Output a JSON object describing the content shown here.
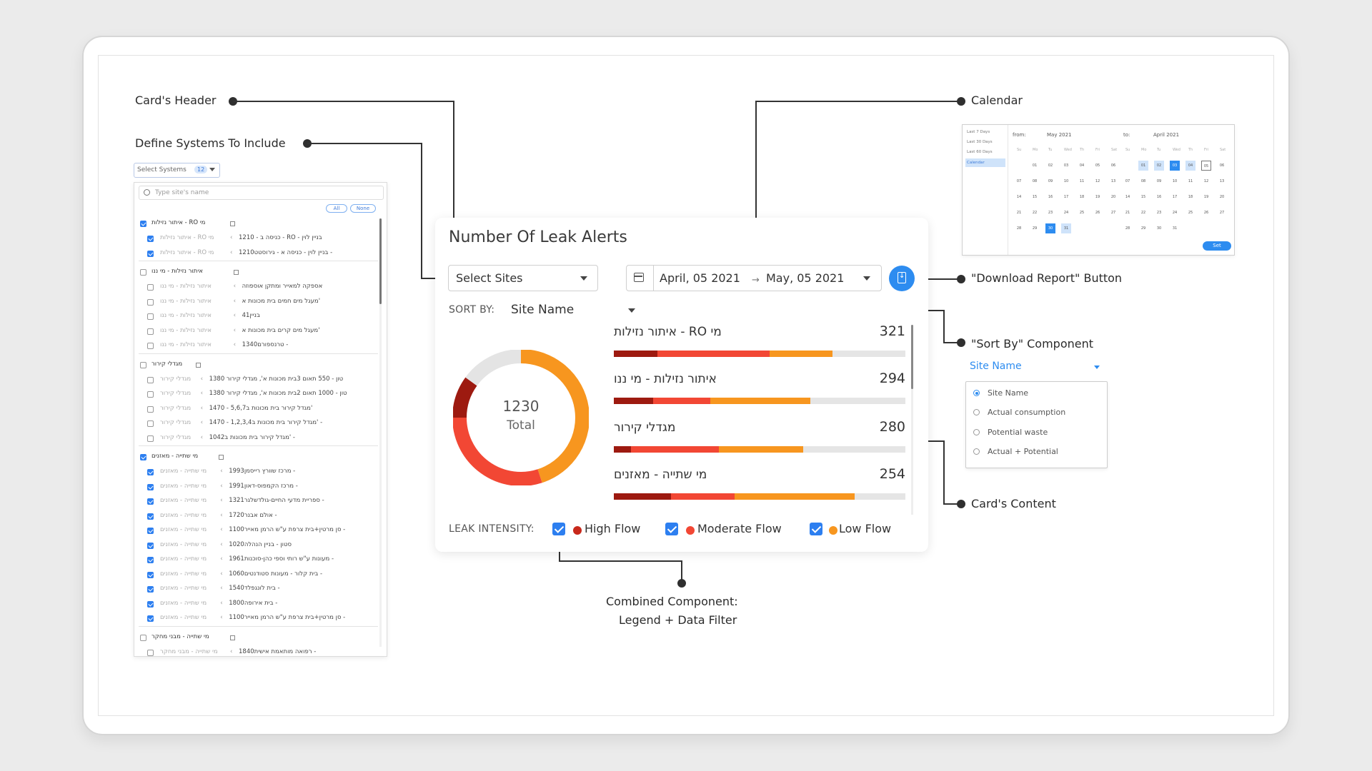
{
  "annotations": {
    "card_header": "Card's Header",
    "define_systems": "Define Systems To Include",
    "calendar": "Calendar",
    "download": "\"Download Report\" Button",
    "sort_by": "\"Sort By\" Component",
    "card_content": "Card's Content",
    "combined_line1": "Combined Component:",
    "combined_line2": "Legend + Data Filter"
  },
  "systems": {
    "select_label": "Select Systems",
    "count": "12",
    "search_placeholder": "Type site's name",
    "all": "All",
    "none": "None",
    "groups": [
      {
        "name": "איתור נזילות - RO מי",
        "checked": true,
        "items": [
          {
            "a": "איתור נזילות - RO מי",
            "b": "כניסה ב - 1210 - RO - בניין לוין",
            "checked": true
          },
          {
            "a": "איתור נזילות - RO מי",
            "b": "בניין לוין - כניסה א - גירוסטט1210 -",
            "checked": true
          }
        ]
      },
      {
        "name": "איתור נזילות - מי ננו",
        "checked": false,
        "items": [
          {
            "a": "איתור נזילות - מי ננו",
            "b": "אספקה למאייר ומתקן אוספוזה",
            "checked": false
          },
          {
            "a": "איתור נזילות - מי ננו",
            "b": "מעגל מים חמים בית מכונות א'",
            "checked": false
          },
          {
            "a": "איתור נזילות - מי ננו",
            "b": "בניין41",
            "checked": false
          },
          {
            "a": "איתור נזילות - מי ננו",
            "b": "מעגל מים קרים בית מכונות א'",
            "checked": false
          },
          {
            "a": "איתור נזילות - מי ננו",
            "b": "1340טרנספורם -",
            "checked": false
          }
        ]
      },
      {
        "name": "מגדלי קירור",
        "checked": false,
        "items": [
          {
            "a": "מגדלי קירור",
            "b": "טון - 550 תאום 3בית מכונות א', מגדלי קירור 1380",
            "checked": false
          },
          {
            "a": "מגדלי קירור",
            "b": "טון - 1000 תאום 2בית מכונות א', מגדלי קירור 1380",
            "checked": false
          },
          {
            "a": "מגדלי קירור",
            "b": "1470 - 5,6,7מגדל קירור בית מכונות ב'",
            "checked": false
          },
          {
            "a": "מגדלי קירור",
            "b": "1470 - 1,2,3,4מגדל קירור בית מכונות ב' -",
            "checked": false
          },
          {
            "a": "מגדלי קירור",
            "b": "1042מגדל קירור בית מכונות ב' -",
            "checked": false
          }
        ]
      },
      {
        "name": "מי שתייה - מאזנים",
        "checked": true,
        "items": [
          {
            "a": "מי שתייה - מאזנים",
            "b": "1993מרכז שוורץ רייסמן -",
            "checked": true
          },
          {
            "a": "מי שתייה - מאזנים",
            "b": "1991מרכז הקמפוס-דאון -",
            "checked": true
          },
          {
            "a": "מי שתייה - מאזנים",
            "b": "1321ספריית מדעי החיים-גולדשלגר -",
            "checked": true
          },
          {
            "a": "מי שתייה - מאזנים",
            "b": "1720אולם אבנר -",
            "checked": true
          },
          {
            "a": "מי שתייה - מאזנים",
            "b": "1100סן מרטין+בית צרפת ע\"ש הרמן מאייר -",
            "checked": true
          },
          {
            "a": "מי שתייה - מאזנים",
            "b": "1020סטון - בניין הנהלה",
            "checked": true
          },
          {
            "a": "מי שתייה - מאזנים",
            "b": "1961מעונות ע\"ש רותי וספי כהן-סוכנות -",
            "checked": true
          },
          {
            "a": "מי שתייה - מאזנים",
            "b": "1060בית קלור - מעונות סטודנטים -",
            "checked": true
          },
          {
            "a": "מי שתייה - מאזנים",
            "b": "1540בית לונגפלד -",
            "checked": true
          },
          {
            "a": "מי שתייה - מאזנים",
            "b": "1800בית אירופה -",
            "checked": true
          },
          {
            "a": "מי שתייה - מאזנים",
            "b": "1100סן מרטין+בית צרפת ע\"ש הרמן מאייר -",
            "checked": true
          }
        ]
      },
      {
        "name": "מי שתייה - מבני מחקר",
        "checked": false,
        "items": [
          {
            "a": "מי שתייה - מבני מחקר",
            "b": "1840רפואה מותאמת אישית -",
            "checked": false
          }
        ]
      }
    ]
  },
  "card": {
    "title": "Number Of Leak Alerts",
    "select_sites": "Select Sites",
    "date_from": "April, 05 2021",
    "date_to": "May, 05 2021",
    "sort_by_label": "SORT BY:",
    "sort_by_value": "Site Name",
    "total_value": "1230",
    "total_label": "Total",
    "legend_label": "LEAK INTENSITY:",
    "legend": [
      {
        "name": "High Flow",
        "color": "#c8281b"
      },
      {
        "name": "Moderate Flow",
        "color": "#f24734"
      },
      {
        "name": "Low Flow",
        "color": "#f7961f"
      }
    ]
  },
  "chart_data": [
    {
      "type": "pie",
      "labels": [
        "High Flow",
        "Moderate Flow",
        "Low Flow"
      ],
      "values": [
        10,
        30,
        45
      ],
      "remainder_gray": 15,
      "center_value": 1230,
      "center_label": "Total"
    },
    {
      "type": "bar",
      "stacked": true,
      "categories": [
        "איתור נזילות - RO מי",
        "איתור נזילות - מי ננו",
        "מגדלי קירור",
        "מי שתייה - מאזנים"
      ],
      "totals": [
        321,
        294,
        280,
        254
      ],
      "series": [
        {
          "name": "High Flow",
          "values": [
            0.15,
            0.135,
            0.06,
            0.195
          ]
        },
        {
          "name": "Moderate Flow",
          "values": [
            0.385,
            0.195,
            0.3,
            0.22
          ]
        },
        {
          "name": "Low Flow",
          "values": [
            0.215,
            0.345,
            0.29,
            0.41
          ]
        }
      ]
    }
  ],
  "calendar": {
    "presets": [
      "Last 7 Days",
      "Last 30 Days",
      "Last 60 Days",
      "Calendar"
    ],
    "from_label": "from:",
    "from_month": "May 2021",
    "to_label": "to:",
    "to_month": "April 2021",
    "day_names": [
      "Su",
      "Mo",
      "Tu",
      "Wed",
      "Th",
      "Fri",
      "Sat"
    ],
    "set": "Set"
  },
  "sort_dropdown": {
    "value": "Site Name",
    "options": [
      "Site Name",
      "Actual consumption",
      "Potential waste",
      "Actual + Potential"
    ],
    "selected": 0
  }
}
